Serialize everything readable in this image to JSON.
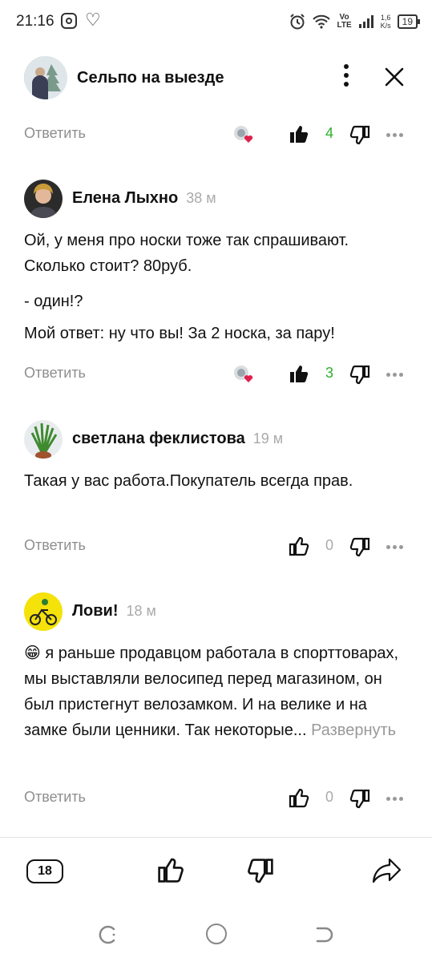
{
  "status_bar": {
    "time": "21:16",
    "network_speed_value": "1,6",
    "network_speed_unit": "K/s",
    "battery": "19",
    "vo_top": "Vo",
    "vo_bottom": "LTE"
  },
  "header": {
    "title": "Сельпо на выезде"
  },
  "comments": [
    {
      "reply_label": "Ответить",
      "likes": "4"
    },
    {
      "author": "Елена Лыхно",
      "time": "38 м",
      "paragraphs": [
        "Ой, у меня про носки тоже так спрашивают. Сколько стоит? 80руб.",
        "- один!?",
        "Мой ответ: ну что вы! За 2 носка, за пару!"
      ],
      "reply_label": "Ответить",
      "likes": "3"
    },
    {
      "author": "светлана феклистова",
      "time": "19 м",
      "paragraphs": [
        "Такая у вас работа.Покупатель всегда прав."
      ],
      "reply_label": "Ответить",
      "likes": "0"
    },
    {
      "author": "Лови!",
      "time": "18 м",
      "emoji": "😁",
      "text": "я раньше продавцом работала в спорттоварах, мы выставляли велосипед перед магазином, он был пристегнут велозамком. И на велике и на замке были ценники. Так некоторые...",
      "expand_label": "Развернуть",
      "reply_label": "Ответить",
      "likes": "0"
    }
  ],
  "bottom_bar": {
    "comment_count": "18"
  },
  "colors": {
    "positive": "#2faf2f",
    "muted": "#8e8e8e"
  },
  "icons": [
    "instagram-icon",
    "health-icon",
    "alarm-icon",
    "wifi-icon",
    "signal-icon",
    "battery-icon",
    "kebab-menu-icon",
    "close-icon",
    "reactions-icon",
    "thumbs-up-icon",
    "thumbs-down-icon",
    "more-dots-icon",
    "share-icon",
    "comments-icon"
  ]
}
